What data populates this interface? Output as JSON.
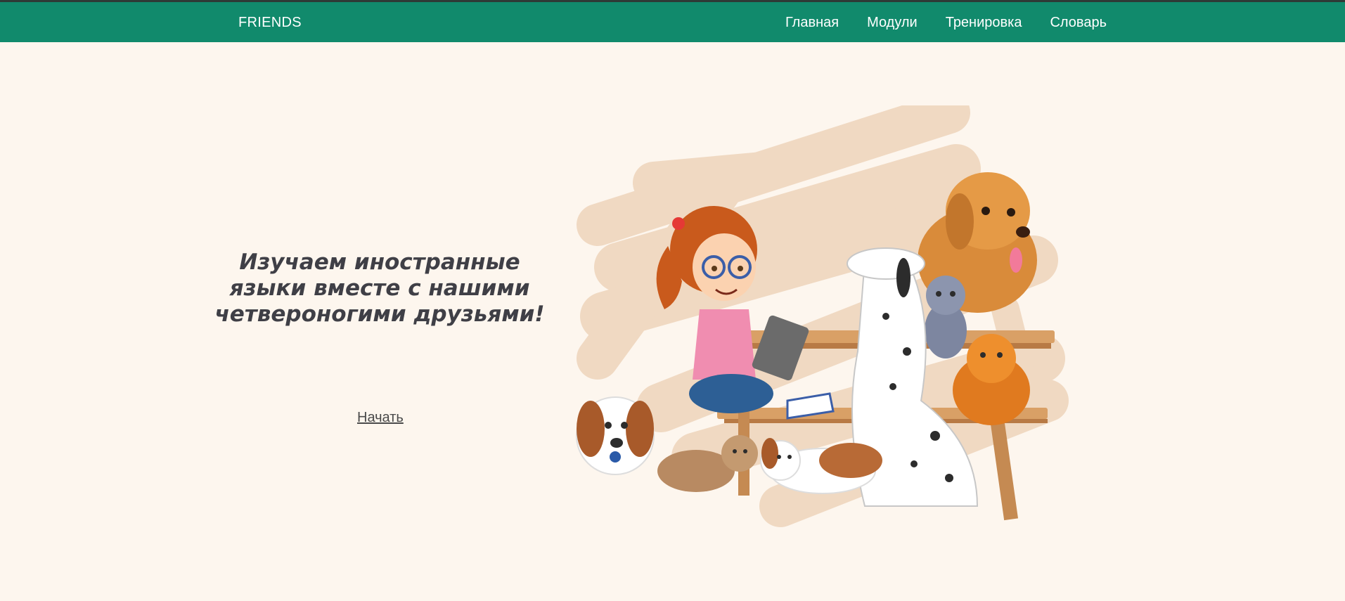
{
  "header": {
    "brand": "FRIENDS",
    "nav": [
      "Главная",
      "Модули",
      "Тренировка",
      "Словарь"
    ]
  },
  "hero": {
    "title": "Изучаем иностранные языки вместе с нашими четвероногими друзьями!",
    "cta_label": "Начать"
  },
  "colors": {
    "header_bg": "#118a6c",
    "page_bg": "#fdf6ee",
    "blob": "#f0d9c2",
    "text_dark": "#3f3f46"
  }
}
